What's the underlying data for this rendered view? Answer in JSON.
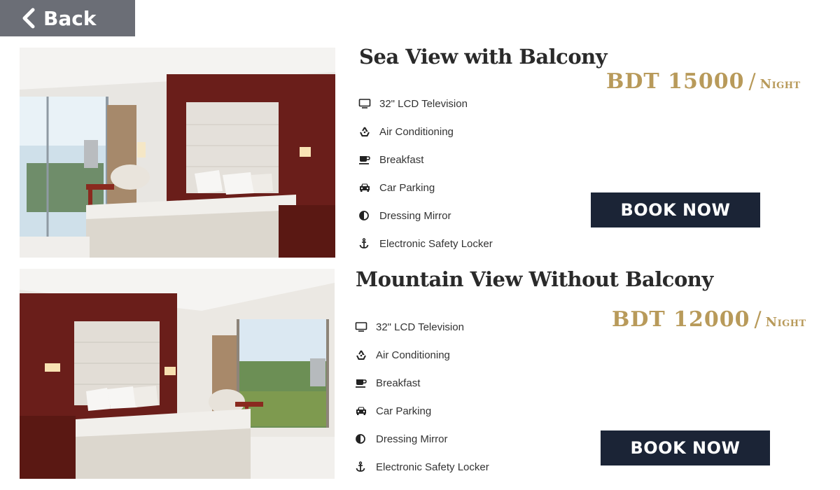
{
  "nav": {
    "back_label": "Back"
  },
  "rooms": [
    {
      "title": "Sea View with Balcony",
      "price": {
        "amount": "BDT 15000",
        "separator": "/",
        "unit": "Night"
      },
      "amenities": [
        {
          "icon": "tv-icon",
          "label": "32\" LCD Television"
        },
        {
          "icon": "recycle-icon",
          "label": "Air Conditioning"
        },
        {
          "icon": "coffee-icon",
          "label": "Breakfast"
        },
        {
          "icon": "car-icon",
          "label": "Car Parking"
        },
        {
          "icon": "contrast-icon",
          "label": "Dressing Mirror"
        },
        {
          "icon": "anchor-icon",
          "label": "Electronic Safety Locker"
        }
      ],
      "book_label": "BOOK NOW"
    },
    {
      "title": "Mountain View Without Balcony",
      "price": {
        "amount": "BDT 12000",
        "separator": "/",
        "unit": "Night"
      },
      "amenities": [
        {
          "icon": "tv-icon",
          "label": "32\" LCD Television"
        },
        {
          "icon": "recycle-icon",
          "label": "Air Conditioning"
        },
        {
          "icon": "coffee-icon",
          "label": "Breakfast"
        },
        {
          "icon": "car-icon",
          "label": "Car Parking"
        },
        {
          "icon": "contrast-icon",
          "label": "Dressing Mirror"
        },
        {
          "icon": "anchor-icon",
          "label": "Electronic Safety Locker"
        }
      ],
      "book_label": "BOOK NOW"
    }
  ],
  "colors": {
    "back_bg": "#6b6e76",
    "price_gold": "#b89a5a",
    "button_navy": "#1b2436"
  }
}
